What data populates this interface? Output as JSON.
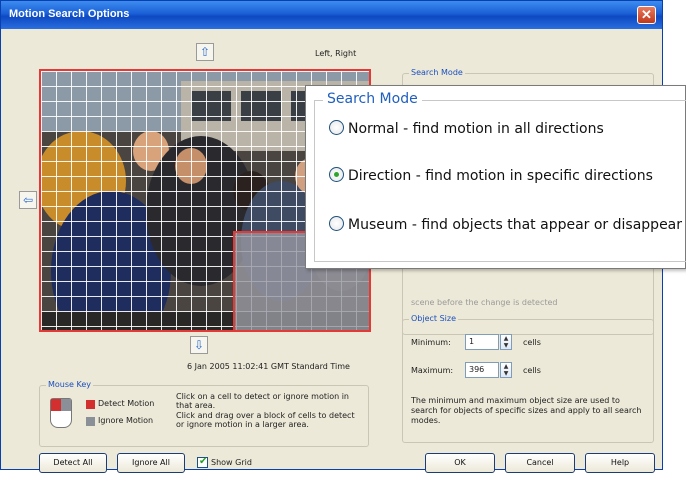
{
  "window": {
    "title": "Motion Search Options",
    "close_glyph": "✕"
  },
  "video": {
    "top_arrow_icon": "up-arrow-icon",
    "left_arrow_icon": "left-arrow-icon",
    "bottom_arrow_icon": "down-arrow-icon",
    "direction_label": "Left, Right",
    "timestamp": "6 Jan 2005 11:02:41 GMT Standard Time"
  },
  "mouse_key": {
    "title": "Mouse Key",
    "detect_label": "Detect Motion",
    "ignore_label": "Ignore Motion",
    "detect_color": "#d32f2f",
    "ignore_color": "#8a8f98",
    "help_click": "Click on a cell to detect or ignore motion in that area.",
    "help_drag": "Click and drag over a block of cells to detect or ignore motion in a larger area."
  },
  "bottom": {
    "detect_all": "Detect All",
    "ignore_all": "Ignore All",
    "show_grid": "Show Grid",
    "show_grid_checked": true,
    "ok": "OK",
    "cancel": "Cancel",
    "help": "Help"
  },
  "search_mode_small": {
    "title": "Search Mode",
    "faded_text": "scene before the change is detected"
  },
  "object_size": {
    "title": "Object Size",
    "minimum_label": "Minimum:",
    "minimum_value": "1",
    "maximum_label": "Maximum:",
    "maximum_value": "396",
    "cells_unit": "cells",
    "description": "The minimum and maximum object size are used to search for objects of specific sizes and apply to all search modes."
  },
  "search_mode_zoom": {
    "title": "Search Mode",
    "options": [
      {
        "label": "Normal - find motion in all directions",
        "selected": false
      },
      {
        "label": "Direction - find motion in specific directions",
        "selected": true
      },
      {
        "label": "Museum - find objects that appear or disappear",
        "selected": false
      }
    ]
  }
}
